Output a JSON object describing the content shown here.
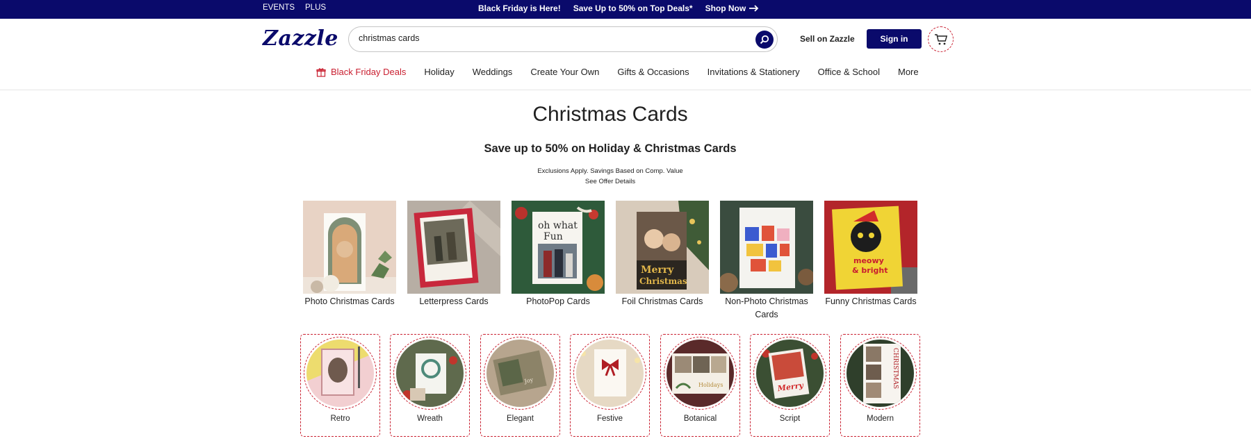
{
  "topbar": {
    "left_links": [
      "EVENTS",
      "PLUS"
    ],
    "promo_1": "Black Friday is Here!",
    "promo_2": "Save Up to 50% on Top Deals*",
    "promo_3": "Shop Now"
  },
  "header": {
    "logo": "Zazzle",
    "search_value": "christmas cards",
    "sell_label": "Sell on Zazzle",
    "signin_label": "Sign in"
  },
  "nav": {
    "items": [
      "Black Friday Deals",
      "Holiday",
      "Weddings",
      "Create Your Own",
      "Gifts & Occasions",
      "Invitations & Stationery",
      "Office & School",
      "More"
    ]
  },
  "main": {
    "title": "Christmas Cards",
    "subtitle": "Save up to 50% on Holiday & Christmas Cards",
    "exclusions": "Exclusions Apply. Savings Based on Comp. Value",
    "offer_details": "See Offer Details",
    "categories": [
      {
        "label": "Photo Christmas Cards"
      },
      {
        "label": "Letterpress Cards"
      },
      {
        "label": "PhotoPop Cards"
      },
      {
        "label": "Foil Christmas Cards"
      },
      {
        "label": "Non-Photo Christmas Cards"
      },
      {
        "label": "Funny Christmas Cards"
      }
    ],
    "styles": [
      {
        "label": "Retro"
      },
      {
        "label": "Wreath"
      },
      {
        "label": "Elegant"
      },
      {
        "label": "Festive"
      },
      {
        "label": "Botanical"
      },
      {
        "label": "Script"
      },
      {
        "label": "Modern"
      }
    ]
  },
  "colors": {
    "brand_navy": "#0a0a6b",
    "accent_red": "#c91e2f"
  },
  "icons": [
    "search-icon",
    "cart-icon",
    "gift-icon",
    "arrow-right-icon"
  ]
}
